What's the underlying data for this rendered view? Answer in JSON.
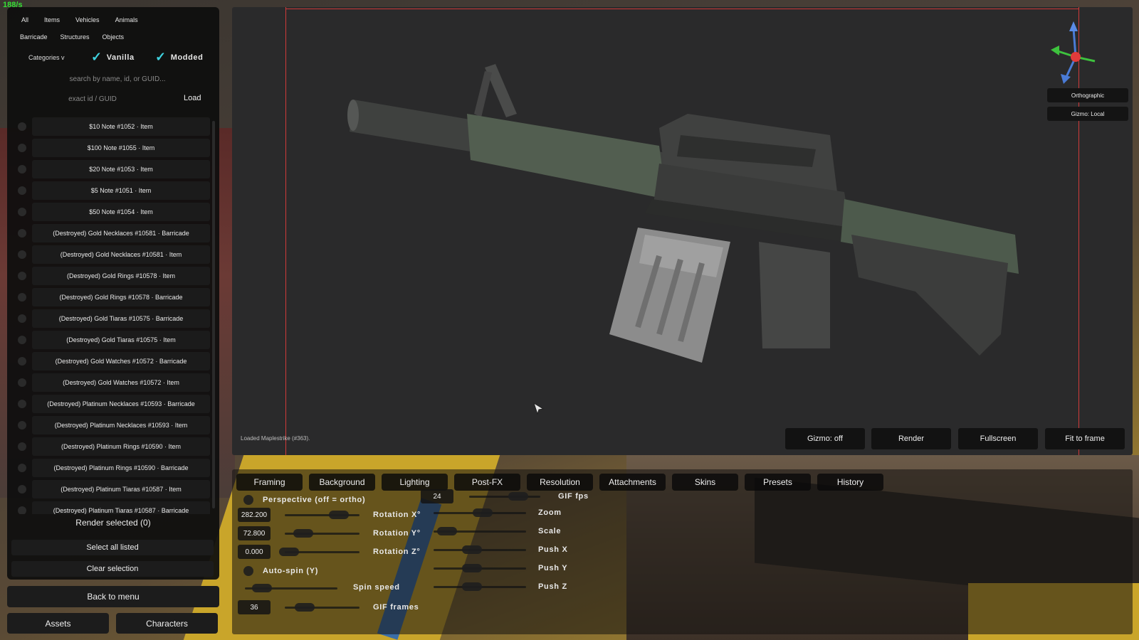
{
  "fps_counter": "188/s",
  "browser": {
    "tabs_row1": [
      "All",
      "Items",
      "Vehicles",
      "Animals"
    ],
    "tabs_row2": [
      "Barricade",
      "Structures",
      "Objects"
    ],
    "categories_label": "Categories v",
    "vanilla_label": "Vanilla",
    "modded_label": "Modded",
    "vanilla_checked": true,
    "modded_checked": true,
    "search_placeholder": "search by name, id, or GUID...",
    "exact_placeholder": "exact id / GUID",
    "load_label": "Load",
    "items": [
      "$10 Note  #1052  · Item",
      "$100 Note  #1055  · Item",
      "$20 Note  #1053  · Item",
      "$5 Note  #1051  · Item",
      "$50 Note  #1054  · Item",
      "(Destroyed) Gold Necklaces  #10581  · Barricade",
      "(Destroyed) Gold Necklaces  #10581  · Item",
      "(Destroyed) Gold Rings  #10578  · Item",
      "(Destroyed) Gold Rings  #10578  · Barricade",
      "(Destroyed) Gold Tiaras  #10575  · Barricade",
      "(Destroyed) Gold Tiaras  #10575  · Item",
      "(Destroyed) Gold Watches  #10572  · Barricade",
      "(Destroyed) Gold Watches  #10572  · Item",
      "(Destroyed) Platinum Necklaces  #10593  · Barricade",
      "(Destroyed) Platinum Necklaces  #10593  · Item",
      "(Destroyed) Platinum Rings  #10590  · Item",
      "(Destroyed) Platinum Rings  #10590  · Barricade",
      "(Destroyed) Platinum Tiaras  #10587  · Item",
      "(Destroyed) Platinum Tiaras  #10587  · Barricade"
    ],
    "render_selected": "Render selected (0)",
    "select_all": "Select all listed",
    "clear_selection": "Clear selection",
    "back_to_menu": "Back to menu",
    "assets_button": "Assets",
    "characters_button": "Characters"
  },
  "viewport": {
    "status": "Loaded Maplestrike (#363).",
    "orthographic_label": "Orthographic",
    "gizmo_space_label": "Gizmo: Local",
    "buttons": {
      "gizmo": "Gizmo: off",
      "render": "Render",
      "fullscreen": "Fullscreen",
      "fit": "Fit to frame"
    }
  },
  "settings": {
    "tabs": [
      "Framing",
      "Background",
      "Lighting",
      "Post-FX",
      "Resolution",
      "Attachments",
      "Skins",
      "Presets",
      "History"
    ],
    "perspective_label": "Perspective (off = ortho)",
    "rotation_x": {
      "label": "Rotation X°",
      "value": "282.200"
    },
    "rotation_y": {
      "label": "Rotation Y°",
      "value": "72.800"
    },
    "rotation_z": {
      "label": "Rotation Z°",
      "value": "0.000"
    },
    "autospin_label": "Auto-spin (Y)",
    "spin_speed_label": "Spin speed",
    "gif_frames": {
      "label": "GIF frames",
      "value": "36"
    },
    "gif_fps": {
      "label": "GIF fps",
      "value": "24"
    },
    "zoom_label": "Zoom",
    "scale_label": "Scale",
    "push_x_label": "Push X",
    "push_y_label": "Push Y",
    "push_z_label": "Push Z"
  }
}
